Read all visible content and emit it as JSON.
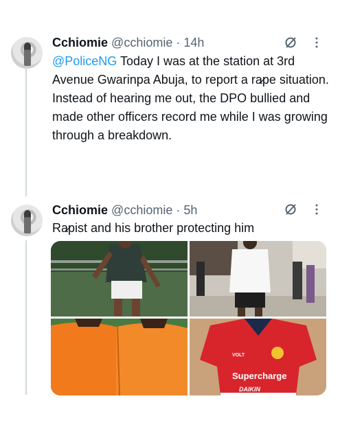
{
  "tweets": [
    {
      "display_name": "Cchiomie",
      "handle": "@cchiomie",
      "separator": "·",
      "time": "14h",
      "mention": "@PoliceNG",
      "text": " Today I was at the station at 3rd Avenue Gwarinpa Abuja, to report a ra̷pe situation. Instead of hearing me out, the DPO bullied and made other officers record me while I was growing through a breakdown."
    },
    {
      "display_name": "Cchiomie",
      "handle": "@cchiomie",
      "separator": "·",
      "time": "5h",
      "text": "Ra̷pist and his brother protecting him"
    }
  ],
  "media": {
    "jersey_text_1": "Supercharge",
    "jersey_text_2": "DAIKIN",
    "jersey_text_3": "VOLT"
  },
  "icons": [
    "avatar",
    "grok-icon",
    "more-icon"
  ],
  "colors": {
    "link": "#1d9bf0",
    "secondary": "#536471",
    "thread_line": "#cfd9de"
  }
}
